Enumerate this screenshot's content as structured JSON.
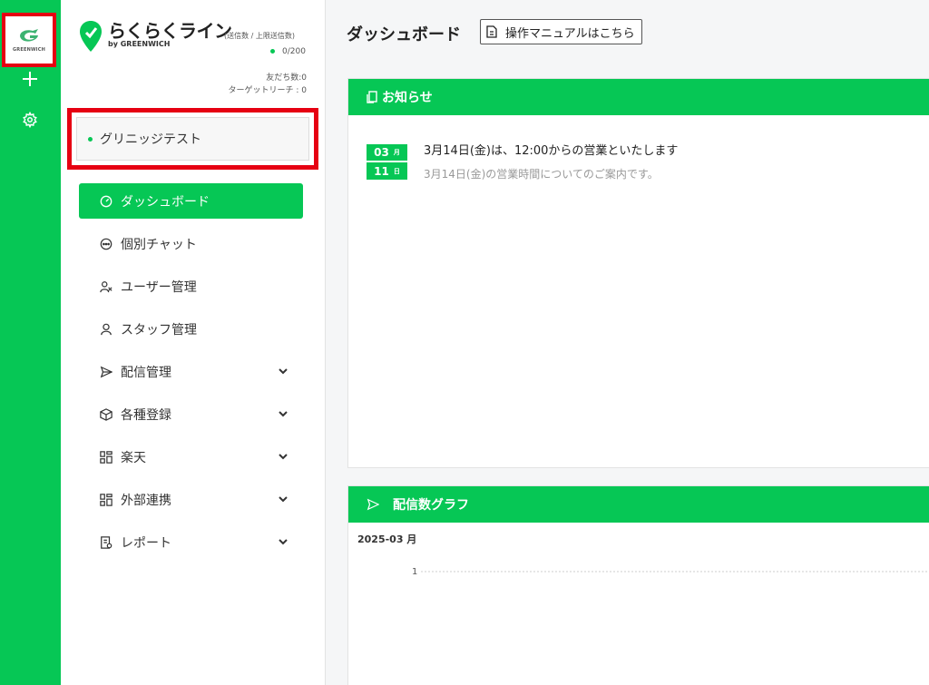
{
  "rail": {
    "logo_text": "GREENWICH",
    "add_icon": "plus-icon",
    "settings_icon": "gear-icon"
  },
  "brand": {
    "name": "らくらくライン",
    "sub": "by GREENWICH",
    "count_label": "(送信数 / 上限送信数)",
    "count": "0/200",
    "friends": "友だち数:0",
    "reach": "ターゲットリーチ : 0"
  },
  "account": {
    "name": "グリニッジテスト"
  },
  "nav": [
    {
      "label": "ダッシュボード",
      "icon": "dashboard-icon",
      "active": true
    },
    {
      "label": "個別チャット",
      "icon": "chat-icon"
    },
    {
      "label": "ユーザー管理",
      "icon": "users-icon"
    },
    {
      "label": "スタッフ管理",
      "icon": "user-icon"
    },
    {
      "label": "配信管理",
      "icon": "send-icon",
      "expandable": true
    },
    {
      "label": "各種登録",
      "icon": "box-icon",
      "expandable": true
    },
    {
      "label": "楽天",
      "icon": "grid-icon",
      "expandable": true
    },
    {
      "label": "外部連携",
      "icon": "grid-icon",
      "expandable": true
    },
    {
      "label": "レポート",
      "icon": "report-icon",
      "expandable": true
    }
  ],
  "main": {
    "title": "ダッシュボード",
    "manual_button": "操作マニュアルはこちら"
  },
  "notice_card": {
    "title": "お知らせ",
    "items": [
      {
        "month": "03",
        "month_unit": "月",
        "day": "11",
        "day_unit": "日",
        "title": "3月14日(金)は、12:00からの営業といたします",
        "desc": "3月14日(金)の営業時間についてのご案内です。"
      }
    ]
  },
  "graph_card": {
    "title": "配信数グラフ",
    "month": "2025-03 月",
    "y_tick": "1"
  },
  "colors": {
    "brand_green": "#06c755",
    "highlight_red": "#e60012"
  }
}
